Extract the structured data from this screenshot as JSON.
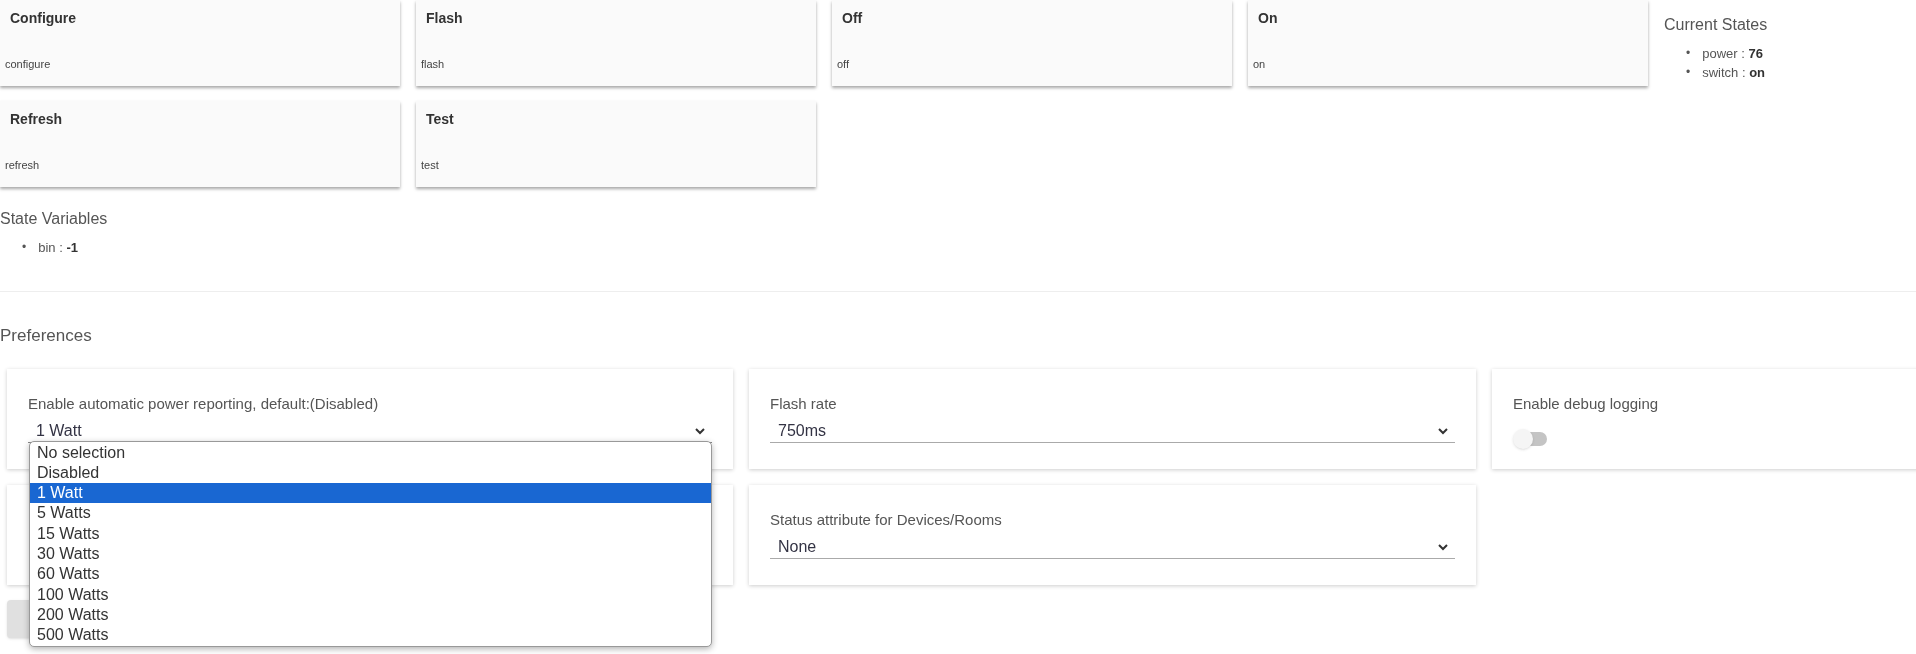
{
  "commands": [
    {
      "title": "Configure",
      "name": "configure"
    },
    {
      "title": "Flash",
      "name": "flash"
    },
    {
      "title": "Off",
      "name": "off"
    },
    {
      "title": "On",
      "name": "on"
    },
    {
      "title": "Refresh",
      "name": "refresh"
    },
    {
      "title": "Test",
      "name": "test"
    }
  ],
  "current_states": {
    "title": "Current States",
    "items": [
      {
        "marker": "•",
        "name": "power :",
        "value": "76"
      },
      {
        "marker": "•",
        "name": "switch :",
        "value": "on"
      }
    ]
  },
  "state_variables": {
    "title": "State Variables",
    "items": [
      {
        "marker": "•",
        "name": "bin :",
        "value": "-1"
      }
    ]
  },
  "preferences": {
    "title": "Preferences",
    "items": [
      {
        "kind": "select",
        "label": "Enable automatic power reporting, default:(Disabled)",
        "value": "1 Watt",
        "expanded": true,
        "options": [
          {
            "label": "No selection",
            "selected": false
          },
          {
            "label": "Disabled",
            "selected": false
          },
          {
            "label": "1 Watt",
            "selected": true
          },
          {
            "label": "5 Watts",
            "selected": false
          },
          {
            "label": "15 Watts",
            "selected": false
          },
          {
            "label": "30 Watts",
            "selected": false
          },
          {
            "label": "60 Watts",
            "selected": false
          },
          {
            "label": "100 Watts",
            "selected": false
          },
          {
            "label": "200 Watts",
            "selected": false
          },
          {
            "label": "500 Watts",
            "selected": false
          }
        ]
      },
      {
        "kind": "select",
        "label": "Flash rate",
        "value": "750ms",
        "expanded": false
      },
      {
        "kind": "toggle",
        "label": "Enable debug logging",
        "on": false
      },
      {
        "kind": "select",
        "label": "Status attribute for Devices/Rooms",
        "value": "None",
        "expanded": false
      }
    ]
  }
}
